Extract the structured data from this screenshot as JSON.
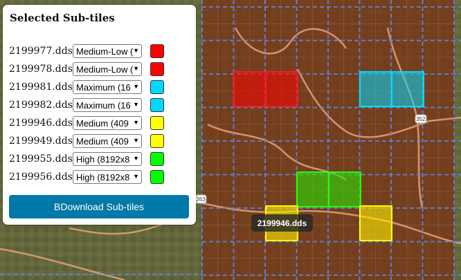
{
  "panel": {
    "title": "Selected Sub-tiles",
    "download_label": "BDownload Sub-tiles"
  },
  "rows": [
    {
      "file": "2199977.dds",
      "level": "Medium-Low (",
      "color": "#ff0000"
    },
    {
      "file": "2199978.dds",
      "level": "Medium-Low (",
      "color": "#ff0000"
    },
    {
      "file": "2199981.dds",
      "level": "Maximum (16",
      "color": "#00d8ff"
    },
    {
      "file": "2199982.dds",
      "level": "Maximum (16",
      "color": "#00d8ff"
    },
    {
      "file": "2199946.dds",
      "level": "Medium (409",
      "color": "#ffff00"
    },
    {
      "file": "2199949.dds",
      "level": "Medium (409",
      "color": "#ffff00"
    },
    {
      "file": "2199955.dds",
      "level": "High (8192x8",
      "color": "#00ff00"
    },
    {
      "file": "2199956.dds",
      "level": "High (8192x8",
      "color": "#00ff00"
    }
  ],
  "map": {
    "tooltip": "2199946.dds",
    "road_labels": [
      "352",
      "263"
    ]
  }
}
